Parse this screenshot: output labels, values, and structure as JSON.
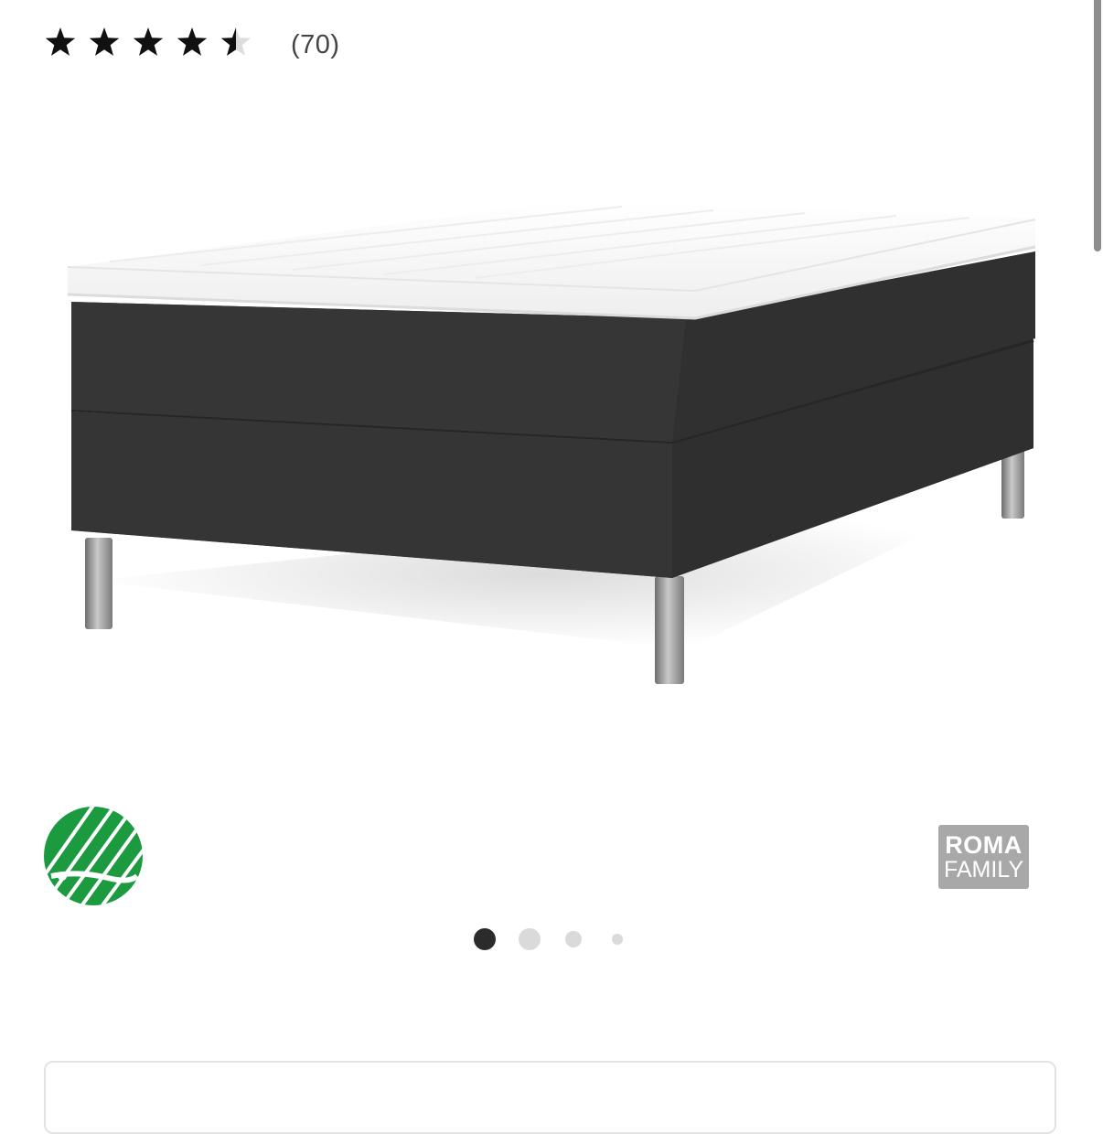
{
  "rating": {
    "stars_total": 5,
    "stars_value": 4.5,
    "review_count_label": "(70)"
  },
  "product": {
    "image_icon": "boxspring-bed-image"
  },
  "badges": {
    "eco_label_icon": "nordic-swan-ecolabel-icon",
    "brand": {
      "line1": "ROMA",
      "line2": "FAMILY"
    }
  },
  "carousel": {
    "total": 4,
    "active_index": 0
  },
  "colors": {
    "star": "#111111",
    "star_empty": "#dddddd",
    "eco_green": "#1c9a3f",
    "brand_bg": "#a8a8a8",
    "dot_active": "#2b2b2b",
    "dot_inactive": "#dadada"
  }
}
